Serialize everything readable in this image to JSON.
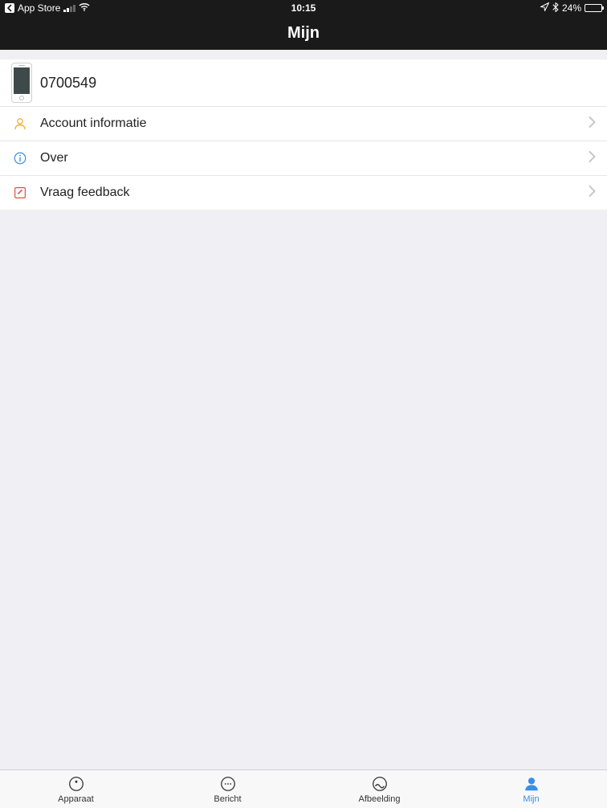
{
  "status": {
    "back_label": "App Store",
    "time": "10:15",
    "battery_pct": "24%",
    "battery_level": 24
  },
  "nav": {
    "title": "Mijn"
  },
  "profile": {
    "id": "0700549"
  },
  "menu": [
    {
      "key": "account",
      "label": "Account informatie",
      "icon": "user",
      "color": "#f5a623"
    },
    {
      "key": "about",
      "label": "Over",
      "icon": "info",
      "color": "#3a8ee6"
    },
    {
      "key": "feedback",
      "label": "Vraag feedback",
      "icon": "edit",
      "color": "#e84c3d"
    }
  ],
  "tabs": [
    {
      "key": "device",
      "label": "Apparaat"
    },
    {
      "key": "message",
      "label": "Bericht"
    },
    {
      "key": "image",
      "label": "Afbeelding"
    },
    {
      "key": "mine",
      "label": "Mijn",
      "active": true
    }
  ]
}
